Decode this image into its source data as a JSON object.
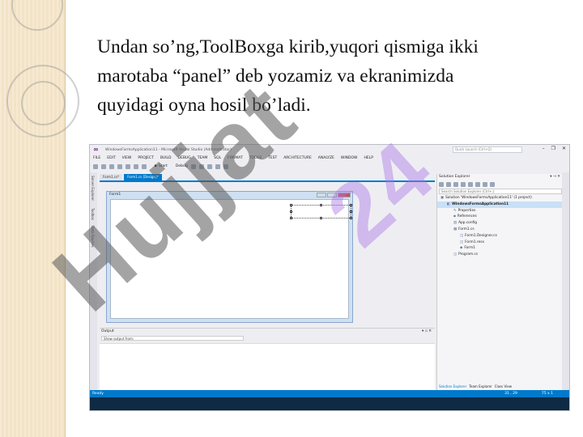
{
  "slide": {
    "caption_lines": [
      "Undan so’ng,ToolBoxga kirib,yuqori qismiga ikki",
      "marotaba  “panel” deb yozamiz va ekranimizda",
      "quyidagi oyna hosil bo’ladi."
    ],
    "watermark_gray": "Hujjat",
    "watermark_purple": "24"
  },
  "vs": {
    "title": "WindowsFormsApplication11 - Microsoft Visual Studio (Administrator)",
    "quick_launch_placeholder": "Quick Launch (Ctrl+Q)",
    "menu": [
      "FILE",
      "EDIT",
      "VIEW",
      "PROJECT",
      "BUILD",
      "DEBUG",
      "TEAM",
      "SQL",
      "FORMAT",
      "TOOLS",
      "TEST",
      "ARCHITECTURE",
      "ANALYZE",
      "WINDOW",
      "HELP"
    ],
    "toolbar": {
      "start_label": "▶ Start",
      "config": "Debug"
    },
    "left_side_tabs": [
      "Server Explorer",
      "Toolbox",
      "Data Sources"
    ],
    "doc_tabs": [
      "Form1.cs*",
      "Form1.cs [Design]*"
    ],
    "form": {
      "title": "Form1"
    },
    "output": {
      "title": "Output",
      "show_from_label": "Show output from:"
    },
    "solution_explorer": {
      "title": "Solution Explorer",
      "search_placeholder": "Search Solution Explorer (Ctrl+;)",
      "tree": [
        {
          "label": "Solution 'WindowsFormsApplication11' (1 project)",
          "depth": 0,
          "icon": "solution-icon"
        },
        {
          "label": "WindowsFormsApplication11",
          "depth": 1,
          "icon": "project-icon",
          "selected": true
        },
        {
          "label": "Properties",
          "depth": 2,
          "icon": "wrench-icon"
        },
        {
          "label": "References",
          "depth": 2,
          "icon": "references-icon"
        },
        {
          "label": "App.config",
          "depth": 2,
          "icon": "config-icon"
        },
        {
          "label": "Form1.cs",
          "depth": 2,
          "icon": "form-file-icon"
        },
        {
          "label": "Form1.Designer.cs",
          "depth": 3,
          "icon": "cs-file-icon"
        },
        {
          "label": "Form1.resx",
          "depth": 3,
          "icon": "resx-icon"
        },
        {
          "label": "Form1",
          "depth": 3,
          "icon": "class-icon"
        },
        {
          "label": "Program.cs",
          "depth": 2,
          "icon": "cs-file-icon"
        }
      ],
      "tabs": [
        "Solution Explorer",
        "Team Explorer",
        "Class View"
      ]
    },
    "status": {
      "text": "Ready",
      "position": "31 , 29",
      "size": "75 x 1"
    },
    "colors": {
      "accent": "#007acc",
      "logo": "#68217a"
    }
  }
}
